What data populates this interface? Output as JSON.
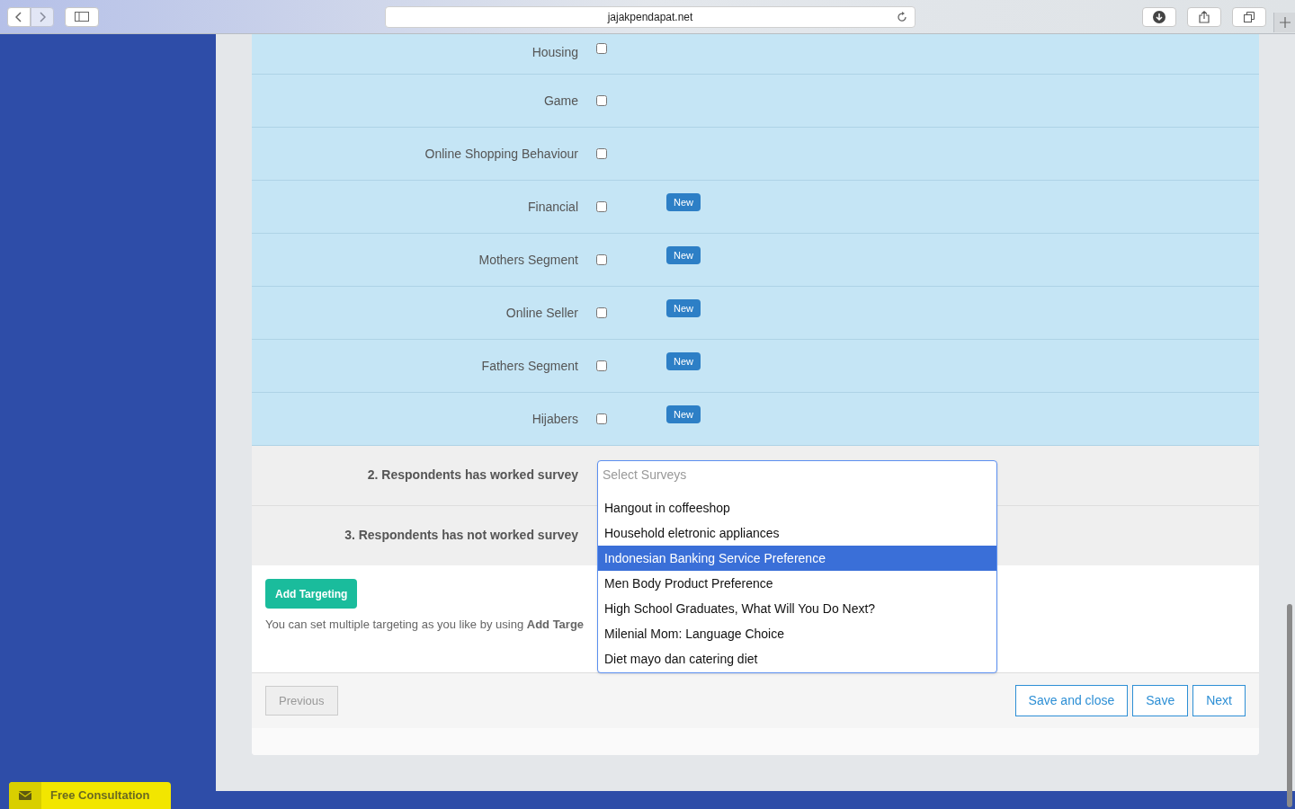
{
  "browser": {
    "url": "jajakpendapat.net"
  },
  "topics": [
    {
      "label": "Housing",
      "checked": false
    },
    {
      "label": "Game",
      "checked": false
    },
    {
      "label": "Online Shopping Behaviour",
      "checked": false
    },
    {
      "label": "Financial",
      "checked": false,
      "badge": "New"
    },
    {
      "label": "Mothers Segment",
      "checked": false,
      "badge": "New"
    },
    {
      "label": "Online Seller",
      "checked": false,
      "badge": "New"
    },
    {
      "label": "Fathers Segment",
      "checked": false,
      "badge": "New"
    },
    {
      "label": "Hijabers",
      "checked": false,
      "badge": "New"
    }
  ],
  "survey_rows": [
    {
      "label": "2. Respondents has worked survey"
    },
    {
      "label": "3. Respondents has not worked survey"
    }
  ],
  "dropdown": {
    "placeholder": "Select Surveys",
    "options": [
      {
        "label": "Hangout in coffeeshop",
        "selected": false
      },
      {
        "label": "Household eletronic appliances",
        "selected": false
      },
      {
        "label": "Indonesian Banking Service Preference",
        "selected": true
      },
      {
        "label": "Men Body Product Preference",
        "selected": false
      },
      {
        "label": "High School Graduates, What Will You Do Next?",
        "selected": false
      },
      {
        "label": "Milenial Mom: Language Choice",
        "selected": false
      },
      {
        "label": "Diet mayo dan catering diet",
        "selected": false
      }
    ]
  },
  "add_targeting": {
    "button": "Add Targeting",
    "hint": "You can set multiple targeting as you like by using **Add Targe**"
  },
  "footer": {
    "previous": {
      "label": "Previous",
      "disabled": true
    },
    "buttons": [
      "Save and close",
      "Save",
      "Next"
    ]
  },
  "consultation": "Free Consultation"
}
